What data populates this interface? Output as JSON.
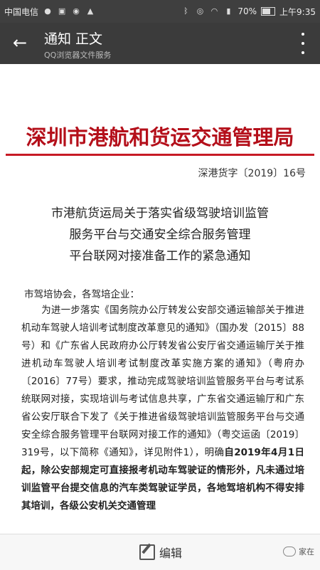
{
  "status_bar": {
    "carrier": "中国电信",
    "battery_percent": "70%",
    "battery_level": 0.7,
    "time": "上午9:35",
    "icons_left": [
      "wechat-icon",
      "image-icon",
      "qq-icon",
      "signal-icon"
    ],
    "icons_right": [
      "bluetooth-icon",
      "eye-icon",
      "wifi-icon",
      "4g-signal-icon",
      "battery-icon"
    ]
  },
  "appbar": {
    "title": "通知 正文",
    "subtitle": "QQ浏览器文件服务"
  },
  "document": {
    "organization": "深圳市港航和货运交通管理局",
    "doc_number": "深港货字〔2019〕16号",
    "headline_lines": [
      "市港航货运局关于落实省级驾驶培训监管",
      "服务平台与交通安全综合服务管理",
      "平台联网对接准备工作的紧急通知"
    ],
    "greeting": "市驾培协会，各驾培企业：",
    "body_normal": "为进一步落实《国务院办公厅转发公安部交通运输部关于推进机动车驾驶人培训考试制度改革意见的通知》（国办发〔2015〕88号）和《广东省人民政府办公厅转发省公安厅省交通运输厅关于推进机动车驾驶人培训考试制度改革实施方案的通知》（粤府办〔2016〕77号）要求，推动完成驾驶培训监管服务平台与考试系统联网对接，实现培训与考试信息共享，广东省交通运输厅和广东省公安厅联合下发了《关于推进省级驾驶培训监管服务平台与交通安全综合服务管理平台联网对接工作的通知》（粤交运函〔2019〕319号，以下简称《通知》，详见附件1），明确",
    "body_bold": "自2019年4月1日起，除公安部规定可直接报考机动车驾驶证的情形外，凡未通过培训监管平台提交信息的汽车类驾驶证学员，各地驾培机构不得安排其培训，各级公安机关交通管理"
  },
  "bottom_bar": {
    "edit_label": "编辑",
    "watermark": "家在"
  }
}
